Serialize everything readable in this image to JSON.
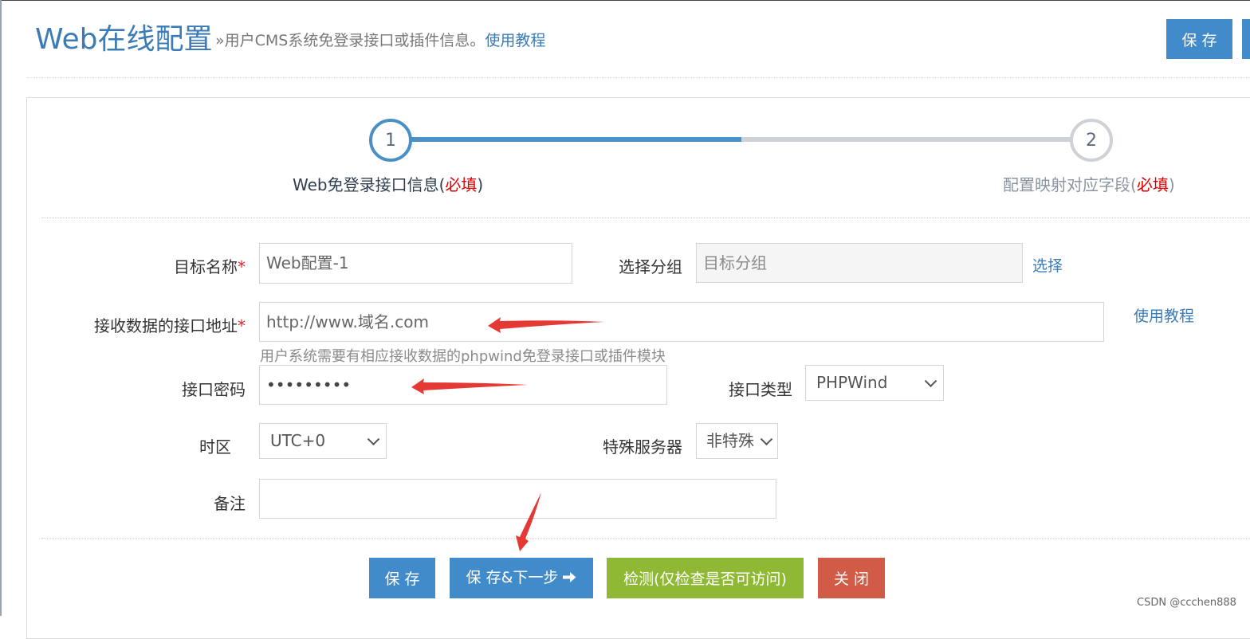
{
  "header": {
    "title": "Web在线配置",
    "description": "»用户CMS系统免登录接口或插件信息。",
    "tutorial_link": "使用教程",
    "save_label": "保 存"
  },
  "steps": [
    {
      "number": "1",
      "label": "Web免登录接口信息(",
      "required": "必填",
      "close": ")",
      "active": true
    },
    {
      "number": "2",
      "label": "配置映射对应字段(",
      "required": "必填",
      "close": ")",
      "active": false
    }
  ],
  "form": {
    "target_name": {
      "label": "目标名称",
      "required_mark": "*",
      "value": "Web配置-1"
    },
    "group": {
      "label": "选择分组",
      "placeholder": "目标分组",
      "select_link": "选择"
    },
    "api_url": {
      "label": "接收数据的接口地址",
      "required_mark": "*",
      "value": "http://www.域名.com",
      "help": "用户系统需要有相应接收数据的phpwind免登录接口或插件模块",
      "tutorial_link": "使用教程"
    },
    "api_password": {
      "label": "接口密码",
      "value": "•••••••••"
    },
    "api_type": {
      "label": "接口类型",
      "value": "PHPWind"
    },
    "timezone": {
      "label": "时区",
      "value": "UTC+0"
    },
    "special_server": {
      "label": "特殊服务器",
      "value": "非特殊"
    },
    "remark": {
      "label": "备注",
      "value": ""
    }
  },
  "actions": {
    "save": "保 存",
    "save_next": "保 存&下一步",
    "check": "检测(仅检查是否可访问)",
    "close": "关 闭"
  },
  "colors": {
    "primary": "#428bca",
    "title": "#3c7cb6",
    "success": "#8fb935",
    "danger": "#d15b47",
    "annotation_arrow": "#e53935"
  },
  "watermark": "CSDN @ccchen888"
}
